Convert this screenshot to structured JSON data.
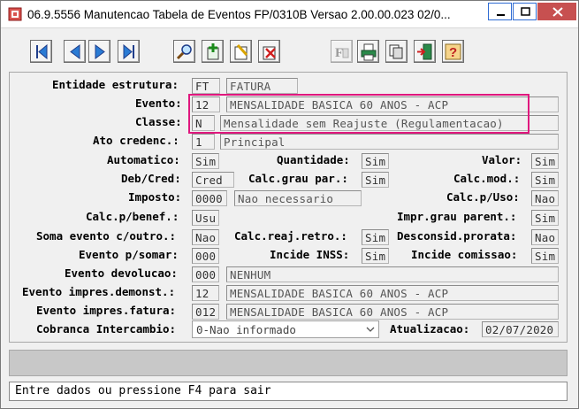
{
  "window": {
    "title": "06.9.5556 Manutencao  Tabela de Eventos FP/0310B Versao 2.00.00.023 02/0..."
  },
  "toolbar": {
    "buttons": [
      "first-record",
      "previous-record",
      "next-record",
      "last-record",
      "search",
      "add",
      "edit",
      "delete",
      "report",
      "print",
      "copy",
      "exit",
      "help"
    ]
  },
  "form": {
    "entidade": {
      "label": "Entidade estrutura:",
      "code": "FT",
      "desc": "FATURA"
    },
    "evento": {
      "label": "Evento:",
      "code": "12",
      "desc": "MENSALIDADE BASICA 60 ANOS - ACP"
    },
    "classe": {
      "label": "Classe:",
      "code": "N",
      "desc": "Mensalidade sem Reajuste (Regulamentacao)"
    },
    "ato": {
      "label": "Ato credenc.:",
      "code": "1",
      "desc": "Principal"
    },
    "automatico": {
      "label": "Automatico:",
      "value": "Sim"
    },
    "quantidade": {
      "label": "Quantidade:",
      "value": "Sim"
    },
    "valor": {
      "label": "Valor:",
      "value": "Sim"
    },
    "debcred": {
      "label": "Deb/Cred:",
      "value": "Cred"
    },
    "calcgrau": {
      "label": "Calc.grau par.:",
      "value": "Sim"
    },
    "calcmod": {
      "label": "Calc.mod.:",
      "value": "Sim"
    },
    "imposto": {
      "label": "Imposto:",
      "code": "0000",
      "desc": "Nao necessario"
    },
    "calcuso": {
      "label": "Calc.p/Uso:",
      "value": "Nao"
    },
    "calcbenef": {
      "label": "Calc.p/benef.:",
      "value": "Usu"
    },
    "imprgrau": {
      "label": "Impr.grau parent.:",
      "value": "Sim"
    },
    "somaevento": {
      "label": "Soma evento c/outro.:",
      "value": "Nao"
    },
    "calcreaj": {
      "label": "Calc.reaj.retro.:",
      "value": "Sim"
    },
    "desconsid": {
      "label": "Desconsid.prorata:",
      "value": "Nao"
    },
    "eventosomar": {
      "label": "Evento p/somar:",
      "value": "000"
    },
    "incideinss": {
      "label": "Incide INSS:",
      "value": "Sim"
    },
    "incidecomissao": {
      "label": "Incide comissao:",
      "value": "Sim"
    },
    "devolucao": {
      "label": "Evento devolucao:",
      "code": "000",
      "desc": "NENHUM"
    },
    "impresdemonst": {
      "label": "Evento impres.demonst.:",
      "code": "12",
      "desc": "MENSALIDADE BASICA 60 ANOS - ACP"
    },
    "impresfatura": {
      "label": "Evento impres.fatura:",
      "code": "012",
      "desc": "MENSALIDADE BASICA 60 ANOS - ACP"
    },
    "cobranca": {
      "label": "Cobranca Intercambio:",
      "value": "0-Nao informado"
    },
    "atualizacao": {
      "label": "Atualizacao:",
      "value": "02/07/2020"
    }
  },
  "status": {
    "message": "Entre dados ou pressione F4 para sair"
  },
  "colors": {
    "highlight": "#e0177e",
    "close_button": "#c75050"
  }
}
